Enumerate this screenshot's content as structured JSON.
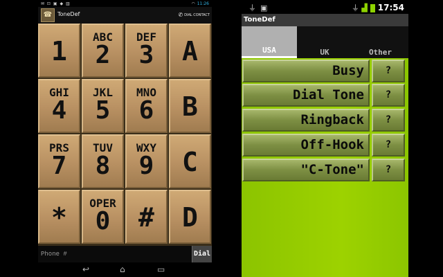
{
  "left": {
    "status_bar": {
      "icons": "✉ ⊡ ▣ ◆ ▥",
      "time": "11:26"
    },
    "app_title": "ToneDef",
    "app_icon": "phone-icon",
    "dial_contact": "DIAL CONTACT",
    "keys": [
      {
        "sub": "",
        "main": "1"
      },
      {
        "sub": "ABC",
        "main": "2"
      },
      {
        "sub": "DEF",
        "main": "3"
      },
      {
        "sub": "",
        "main": "A"
      },
      {
        "sub": "GHI",
        "main": "4"
      },
      {
        "sub": "JKL",
        "main": "5"
      },
      {
        "sub": "MNO",
        "main": "6"
      },
      {
        "sub": "",
        "main": "B"
      },
      {
        "sub": "PRS",
        "main": "7"
      },
      {
        "sub": "TUV",
        "main": "8"
      },
      {
        "sub": "WXY",
        "main": "9"
      },
      {
        "sub": "",
        "main": "C"
      },
      {
        "sub": "",
        "main": "*"
      },
      {
        "sub": "OPER",
        "main": "0"
      },
      {
        "sub": "",
        "main": "#"
      },
      {
        "sub": "",
        "main": "D"
      }
    ],
    "phone_placeholder": "Phone #",
    "dial_label": "Dial"
  },
  "right": {
    "status_bar": {
      "time": "17:54"
    },
    "app_title": "ToneDef",
    "tabs": [
      {
        "label": "USA",
        "active": true
      },
      {
        "label": "UK",
        "active": false
      },
      {
        "label": "Other",
        "active": false
      }
    ],
    "tones": [
      {
        "label": "Busy",
        "help": "?"
      },
      {
        "label": "Dial Tone",
        "help": "?"
      },
      {
        "label": "Ringback",
        "help": "?"
      },
      {
        "label": "Off-Hook",
        "help": "?"
      },
      {
        "label": "\"C-Tone\"",
        "help": "?"
      }
    ],
    "accent_color": "#9dd200"
  }
}
